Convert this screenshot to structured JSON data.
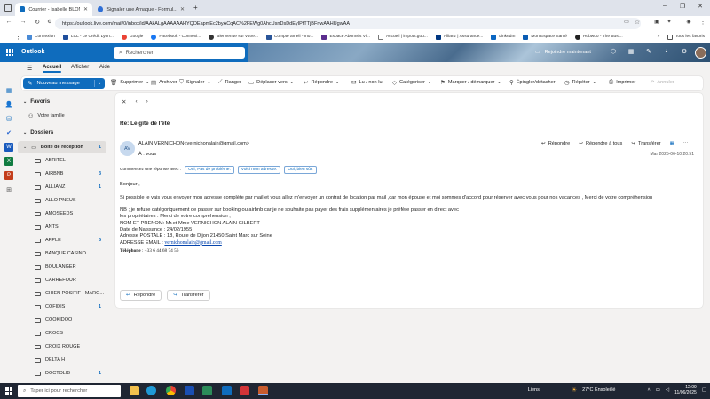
{
  "browser": {
    "tabs": [
      {
        "title": "Courrier - Isabelle BLONDEL - O",
        "active": true,
        "favicon_color": "#0f6cbd"
      },
      {
        "title": "Signaler une Arnaque - Formul...",
        "active": false,
        "favicon_color": "#2f6fd6"
      }
    ],
    "new_tab": "+",
    "url": "https://outlook.live.com/mail/0/inbox/id/AAkALgAAAAAAHYQDEapmEc2byACqAC%2FEWg0AhcUsnDsDdEyIPfTTjBFrlwAAHUgwAA",
    "bookmarks": [
      "Connexion",
      "LCL - Le Crédit Lyon...",
      "Google",
      "Facebook - Connexi...",
      "Bienvenue sur votre...",
      "Compte ameli - mo...",
      "Espace Abonnés Vi...",
      "Accueil | impots.gou...",
      "Allianz | Assurance...",
      "LinkedIn",
      "Mon Espace Santé",
      "Hubwoo - The Busi..."
    ],
    "all_bookmarks": "Tous les favoris"
  },
  "outlook": {
    "brand": "Outlook",
    "search_placeholder": "Rechercher",
    "meet_now": "Rejoindre maintenant",
    "brand_color": "#0f6cbd"
  },
  "ribbon": {
    "tabs": [
      "Accueil",
      "Afficher",
      "Aide"
    ],
    "new_message": "Nouveau message",
    "actions": [
      "Supprimer",
      "Archiver",
      "Signaler",
      "Ranger",
      "Déplacer vers",
      "Répondre",
      "Lu / non lu",
      "Catégoriser",
      "Marquer / démarquer",
      "Épingler/détacher",
      "Répéter",
      "Imprimer",
      "Annuler"
    ]
  },
  "folders": {
    "favorites_label": "Favoris",
    "favorites": [
      {
        "name": "Votre famille"
      }
    ],
    "folders_label": "Dossiers",
    "inbox": {
      "name": "Boîte de réception",
      "count": "1"
    },
    "subfolders": [
      {
        "name": "ABRITEL",
        "count": ""
      },
      {
        "name": "AIRBNB",
        "count": "3"
      },
      {
        "name": "ALLIANZ",
        "count": "1"
      },
      {
        "name": "ALLO PNEUS",
        "count": ""
      },
      {
        "name": "AMOSEEDS",
        "count": ""
      },
      {
        "name": "ANTS",
        "count": ""
      },
      {
        "name": "APPLE",
        "count": "5"
      },
      {
        "name": "BANQUE CASINO",
        "count": ""
      },
      {
        "name": "BOULANGER",
        "count": ""
      },
      {
        "name": "CARREFOUR",
        "count": ""
      },
      {
        "name": "CHIEN POSITIF - MARG...",
        "count": ""
      },
      {
        "name": "COFIDIS",
        "count": "1"
      },
      {
        "name": "COOKIDOO",
        "count": ""
      },
      {
        "name": "CROCS",
        "count": ""
      },
      {
        "name": "CROIX ROUGE",
        "count": ""
      },
      {
        "name": "DELTA H",
        "count": ""
      },
      {
        "name": "DOCTOLIB",
        "count": "1"
      }
    ]
  },
  "message": {
    "subject": "Re: Le gîte de l'été",
    "avatar_initials": "AV",
    "sender": "ALAIN VERNICHON<vernichonalain@gmail.com>",
    "to": "À :  vous",
    "actions": [
      "Répondre",
      "Répondre à tous",
      "Transférer"
    ],
    "date": "Mar 2025-06-10 20:51",
    "suggest_label": "Commencez une réponse avec :",
    "suggestions": [
      "Oui, Pas de problème.",
      "Voici mon adresse.",
      "Oui, bien sûr."
    ],
    "greeting": "Bonjour ,",
    "para1": "Si possible je vais vous envoyer mon adresse complète par mail et vous allez m'envoyer un contrat de location par mail ,car mon épouse et moi sommes d'accord pour réserver avec vous pour nos vacances , Merci de votre compréhension",
    "para2_l1": "NB ; je refuse catégoriquement de passer sur booking ou airbnb car je ne souhaite pas payer des frais supplémentaires je préfère passer en direct avec",
    "para2_l2": "les propriétaires . Merci de votre compréhension ,",
    "name_line": "NOM ET PRENOM: Mr.et Mme  VERNICHON ALAIN GILBERT",
    "birth_line": "Date de Naissance : 24/02/1955",
    "address_line": "Adresse POSTALE : 18, Route de Dijon 21450 Saint Marc sur Seine",
    "email_label": "ADRESSE EMAIL :  ",
    "email_value": "vernichonalain@gmail.com",
    "phone_label": "Téléphone",
    "phone_value": " : +33 6 44 68 74 56",
    "reply_button": "Répondre",
    "forward_button": "Transférer"
  },
  "taskbar": {
    "search_placeholder": "Taper ici pour rechercher",
    "links": "Liens",
    "weather": "27°C  Ensoleillé",
    "time": "12:09",
    "date": "11/06/2025"
  }
}
